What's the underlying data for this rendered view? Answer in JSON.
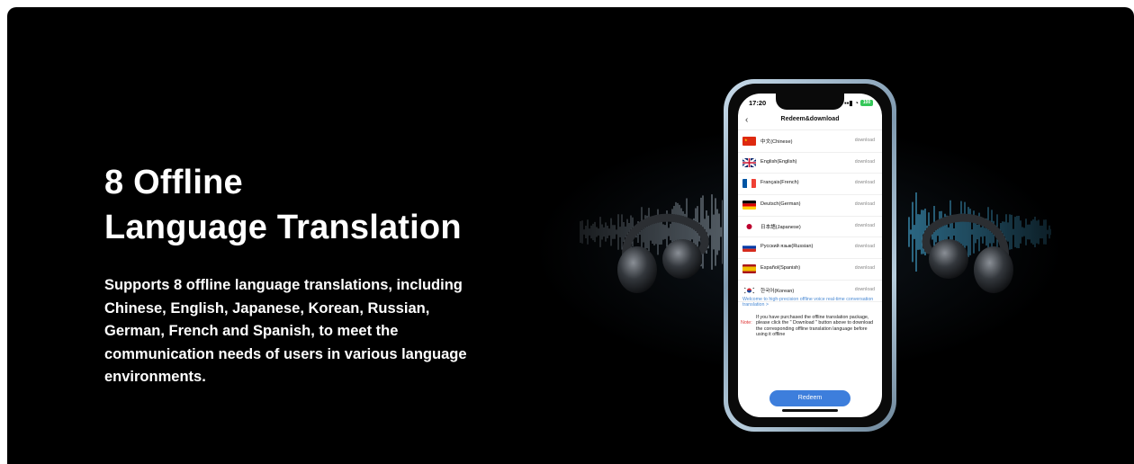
{
  "headline": {
    "line1": "8 Offline",
    "line2": "Language Translation"
  },
  "description": "Supports 8 offline language translations, including Chinese, English, Japanese, Korean, Russian, German, French and Spanish, to meet the communication needs of users in various language environments.",
  "phone": {
    "time": "17:20",
    "battery": "100",
    "title": "Redeem&download",
    "languages": [
      {
        "label": "中文(Chinese)",
        "action": "download",
        "flag": "cn-flag-icon"
      },
      {
        "label": "English(English)",
        "action": "download",
        "flag": "uk-flag-icon"
      },
      {
        "label": "Français(French)",
        "action": "download",
        "flag": "fr-flag-icon"
      },
      {
        "label": "Deutsch(German)",
        "action": "download",
        "flag": "de-flag-icon"
      },
      {
        "label": "日本語(Japanese)",
        "action": "download",
        "flag": "jp-flag-icon"
      },
      {
        "label": "Русский язык(Russian)",
        "action": "download",
        "flag": "ru-flag-icon"
      },
      {
        "label": "Español(Spanish)",
        "action": "download",
        "flag": "es-flag-icon"
      },
      {
        "label": "한국어(Korean)",
        "action": "download",
        "flag": "kr-flag-icon"
      }
    ],
    "welcome": "Welcome to high-precision offline voice real-time conversation translation >",
    "note_label": "Note:",
    "note": "If you have purchased the offline translation package, please click the \" Download \" button above to download the corresponding offline translation language before using it offline",
    "redeem_label": "Redeem"
  },
  "colors": {
    "background": "#000000",
    "accent": "#3d7edc",
    "wave": "#4fc3f7"
  }
}
